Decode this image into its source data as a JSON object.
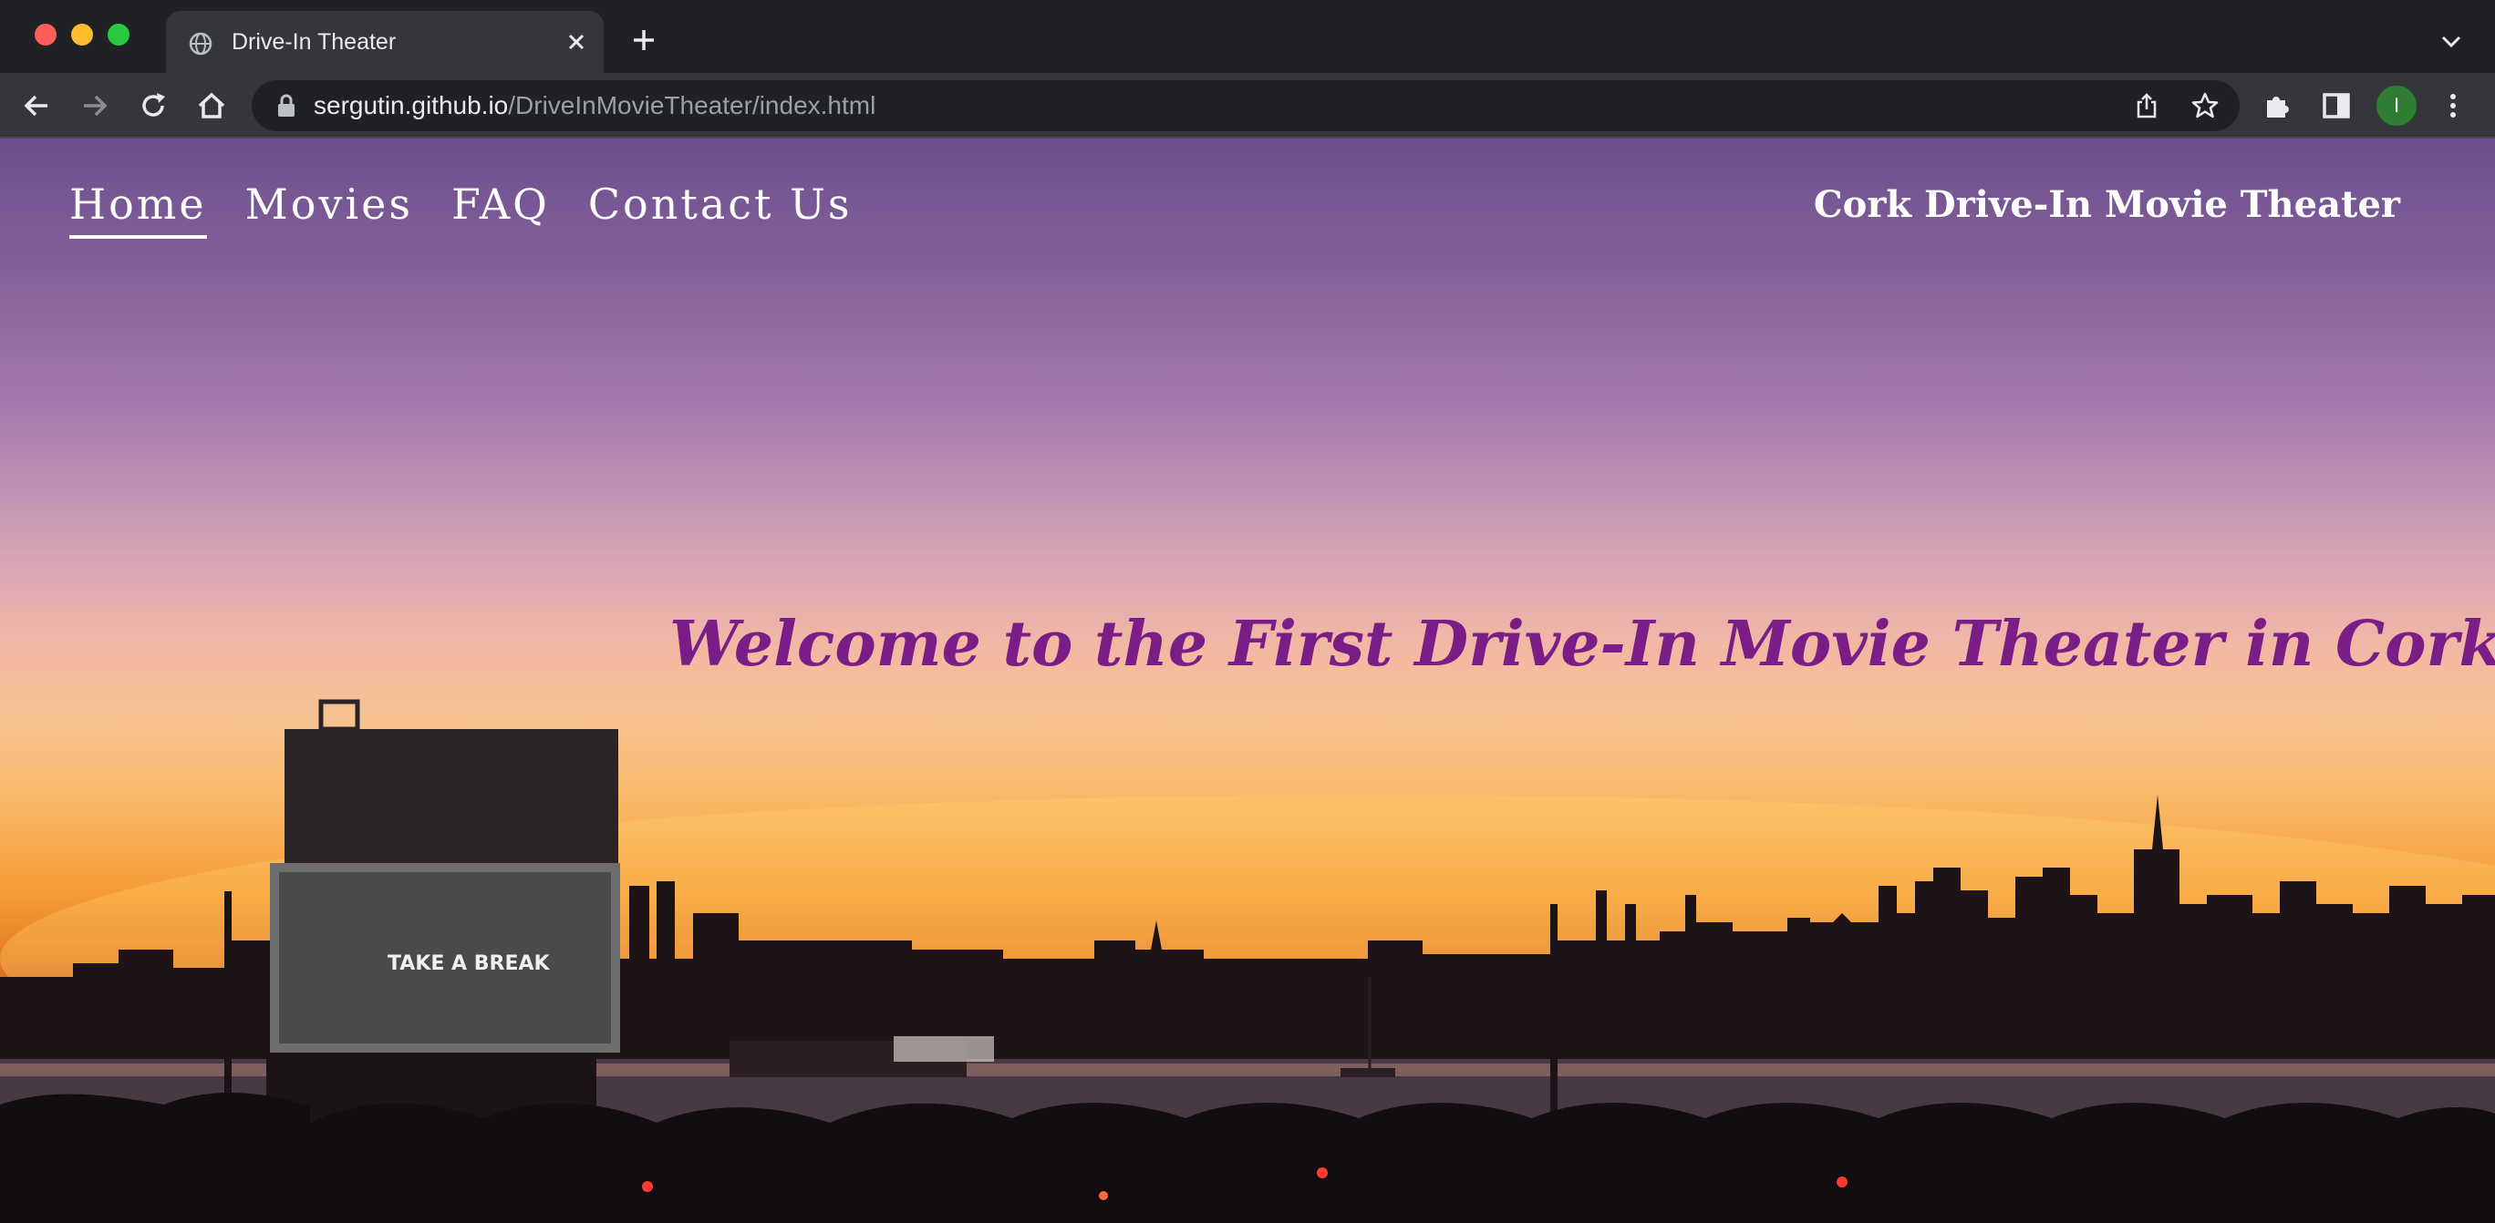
{
  "browser": {
    "tab_title": "Drive-In Theater",
    "url_host": "sergutin.github.io",
    "url_path": "/DriveInMovieTheater/index.html",
    "profile_initial": "I",
    "icons": [
      "globe-icon",
      "close-icon",
      "plus-icon",
      "chevron-down-icon",
      "back-arrow-icon",
      "forward-arrow-icon",
      "reload-icon",
      "home-icon",
      "lock-icon",
      "share-icon",
      "star-icon",
      "puzzle-icon",
      "sidebar-icon",
      "more-vert-icon"
    ]
  },
  "site": {
    "nav": [
      {
        "label": "Home",
        "active": true
      },
      {
        "label": "Movies",
        "active": false
      },
      {
        "label": "FAQ",
        "active": false
      },
      {
        "label": "Contact Us",
        "active": false
      }
    ],
    "brand": "Cork Drive-In Movie Theater",
    "welcome": "Welcome to the First Drive-In Movie Theater in Cork!",
    "screen_text": "TAKE A BREAK"
  },
  "colors": {
    "welcome_text": "#7b1d86",
    "nav_text": "#ffffff",
    "chrome_bg": "#202124",
    "toolbar_bg": "#35363a"
  }
}
